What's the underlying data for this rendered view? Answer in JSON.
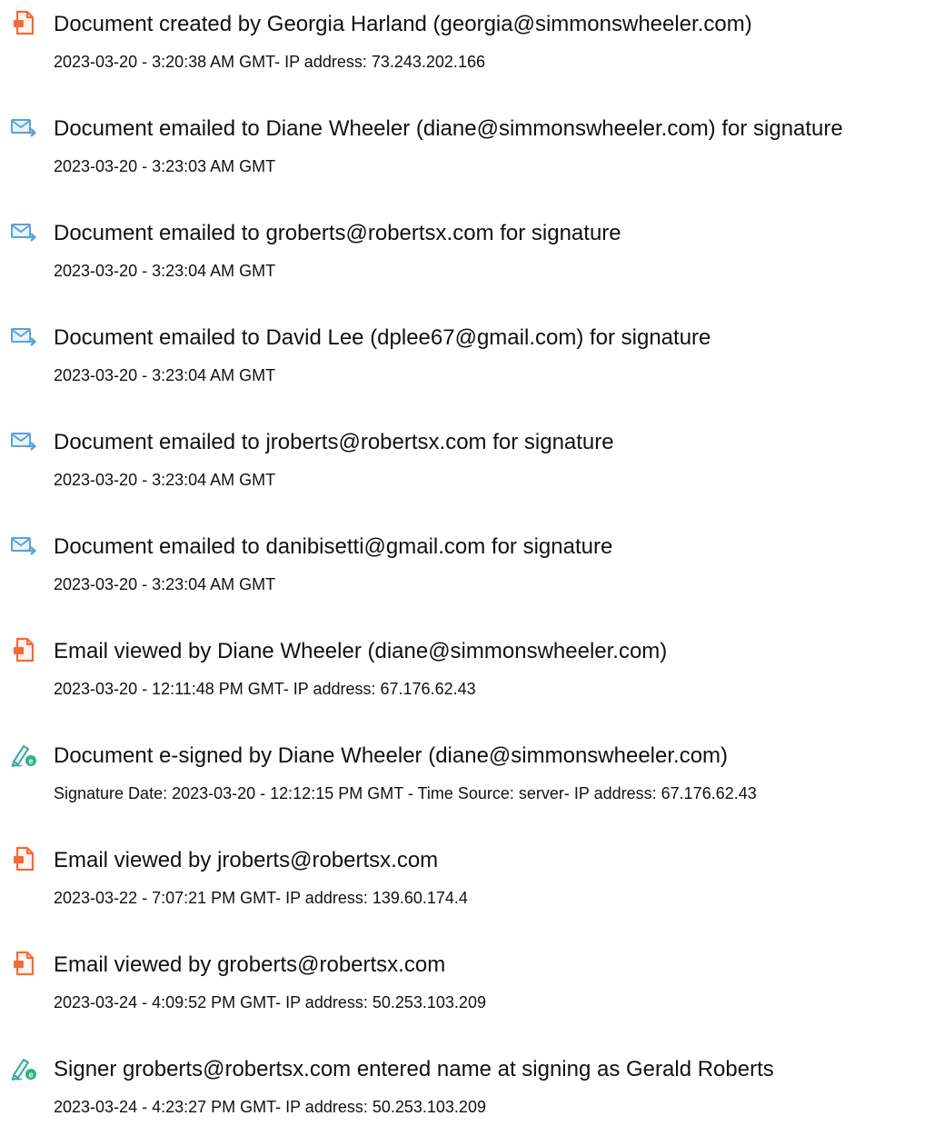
{
  "entries": [
    {
      "icon": "document-created-icon",
      "title": "Document created by Georgia Harland (georgia@simmonswheeler.com)",
      "meta": "2023-03-20 - 3:20:38 AM GMT- IP address: 73.243.202.166"
    },
    {
      "icon": "email-sent-icon",
      "title": "Document emailed to Diane Wheeler (diane@simmonswheeler.com) for signature",
      "meta": "2023-03-20 - 3:23:03 AM GMT"
    },
    {
      "icon": "email-sent-icon",
      "title": "Document emailed to groberts@robertsx.com for signature",
      "meta": "2023-03-20 - 3:23:04 AM GMT"
    },
    {
      "icon": "email-sent-icon",
      "title": "Document emailed to David Lee (dplee67@gmail.com) for signature",
      "meta": "2023-03-20 - 3:23:04 AM GMT"
    },
    {
      "icon": "email-sent-icon",
      "title": "Document emailed to jroberts@robertsx.com for signature",
      "meta": "2023-03-20 - 3:23:04 AM GMT"
    },
    {
      "icon": "email-sent-icon",
      "title": "Document emailed to danibisetti@gmail.com for signature",
      "meta": "2023-03-20 - 3:23:04 AM GMT"
    },
    {
      "icon": "email-viewed-icon",
      "title": "Email viewed by Diane Wheeler (diane@simmonswheeler.com)",
      "meta": "2023-03-20 - 12:11:48 PM GMT- IP address: 67.176.62.43"
    },
    {
      "icon": "e-signed-icon",
      "title": "Document e-signed by Diane Wheeler (diane@simmonswheeler.com)",
      "meta": "Signature Date: 2023-03-20 - 12:12:15 PM GMT - Time Source: server- IP address: 67.176.62.43"
    },
    {
      "icon": "email-viewed-icon",
      "title": "Email viewed by jroberts@robertsx.com",
      "meta": "2023-03-22 - 7:07:21 PM GMT- IP address: 139.60.174.4"
    },
    {
      "icon": "email-viewed-icon",
      "title": "Email viewed by groberts@robertsx.com",
      "meta": "2023-03-24 - 4:09:52 PM GMT- IP address: 50.253.103.209"
    },
    {
      "icon": "e-signed-icon",
      "title": "Signer groberts@robertsx.com entered name at signing as Gerald Roberts",
      "meta": "2023-03-24 - 4:23:27 PM GMT- IP address: 50.253.103.209"
    }
  ],
  "colors": {
    "document_icon": "#f26b3a",
    "email_icon": "#5aa2dc",
    "sign_icon": "#3aa89a",
    "sign_badge": "#2bb585"
  }
}
